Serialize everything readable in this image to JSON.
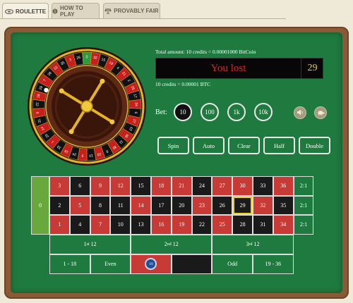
{
  "tabs": [
    {
      "label": "ROULETTE",
      "icon": "roulette-icon",
      "active": true
    },
    {
      "label": "HOW TO PLAY",
      "icon": "info-icon",
      "active": false
    },
    {
      "label": "PROVABLY FAIR",
      "icon": "scales-icon",
      "active": false
    }
  ],
  "info": {
    "total_amount": "Total amount: 10 credits = 0.00001000 BitCoin",
    "conversion": "10 credits = 0.00001 BTC"
  },
  "display": {
    "message": "You lost",
    "number": "29"
  },
  "bet": {
    "label": "Bet:",
    "chips": [
      "10",
      "100",
      "1k",
      "10k"
    ],
    "selected": "10"
  },
  "icons": {
    "sound": "speaker-icon",
    "speed": "turtle-icon"
  },
  "buttons": [
    "Spin",
    "Auto",
    "Clear",
    "Half",
    "Double"
  ],
  "board": {
    "zero": "0",
    "rows": [
      [
        "3",
        "6",
        "9",
        "12",
        "15",
        "18",
        "21",
        "24",
        "27",
        "30",
        "33",
        "36"
      ],
      [
        "2",
        "5",
        "8",
        "11",
        "14",
        "17",
        "20",
        "23",
        "26",
        "29",
        "32",
        "35"
      ],
      [
        "1",
        "4",
        "7",
        "10",
        "13",
        "16",
        "19",
        "22",
        "25",
        "28",
        "31",
        "34"
      ]
    ],
    "reds": [
      "1",
      "3",
      "5",
      "7",
      "9",
      "12",
      "14",
      "16",
      "18",
      "19",
      "21",
      "23",
      "25",
      "27",
      "30",
      "32",
      "34",
      "36"
    ],
    "column_bets": [
      "2:1",
      "2:1",
      "2:1"
    ],
    "dozens": [
      {
        "num": "1",
        "sup": "st",
        "rest": " 12"
      },
      {
        "num": "2",
        "sup": "nd",
        "rest": " 12"
      },
      {
        "num": "3",
        "sup": "rd",
        "rest": " 12"
      }
    ],
    "outside": [
      "1 - 18",
      "Even",
      "",
      "",
      "Odd",
      "19 - 36"
    ],
    "placed_chip": "10",
    "winning_number": "29"
  },
  "wheel": {
    "order": [
      "0",
      "32",
      "15",
      "19",
      "4",
      "21",
      "2",
      "25",
      "17",
      "34",
      "6",
      "27",
      "13",
      "36",
      "11",
      "30",
      "8",
      "23",
      "10",
      "5",
      "24",
      "16",
      "33",
      "1",
      "20",
      "14",
      "31",
      "9",
      "22",
      "18",
      "29",
      "7",
      "28",
      "12",
      "35",
      "3",
      "26"
    ]
  },
  "colors": {
    "felt": "#1f7a3f",
    "red": "#c83a35",
    "black": "#1a1a1a",
    "gold": "#f0d21e",
    "wood": "#8a5a36"
  }
}
